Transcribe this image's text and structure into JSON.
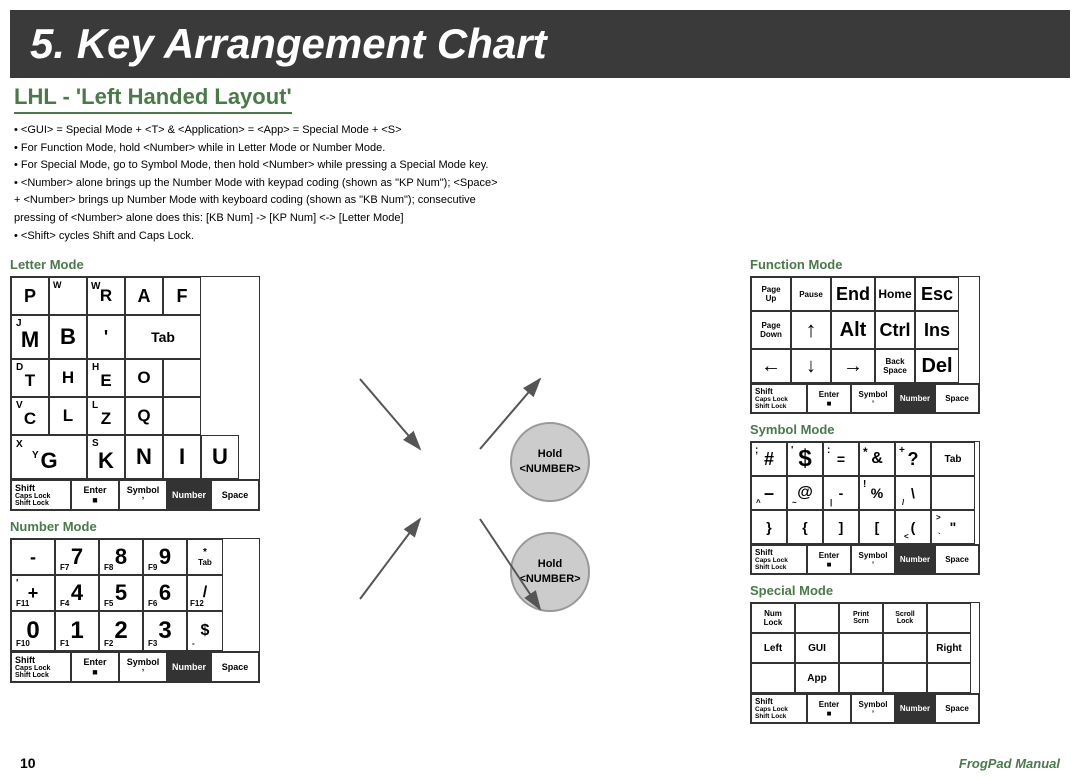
{
  "title": "5. Key Arrangement Chart",
  "subtitle": "LHL - 'Left Handed Layout'",
  "description": [
    "• <GUI> = Special Mode + <T>  &  <Application> = <App> = Special Mode + <S>",
    "• For Function Mode, hold <Number> while in Letter Mode or Number Mode.",
    "• For Special Mode, go to Symbol Mode, then hold <Number> while pressing a Special Mode key.",
    "• <Number> alone brings up the Number Mode with keypad coding (shown as \"KP Num\"); <Space>",
    "+ <Number> brings up Number Mode with keyboard coding (shown as \"KB Num\"); consecutive",
    "pressing of <Number> alone does this: [KB Num]  -> [KP Num] <-> [Letter Mode]",
    "• <Shift> cycles Shift and Caps Lock."
  ],
  "letter_mode": {
    "header": "Letter Mode",
    "rows": [
      [
        "P",
        "W",
        "R",
        "A",
        "F"
      ],
      [
        "J",
        "M B",
        "'",
        "Tab"
      ],
      [
        "D",
        "T",
        "H",
        "E",
        "O"
      ],
      [
        "V",
        "C",
        "L",
        "Z",
        "Q"
      ],
      [
        "",
        "Y G S",
        "N",
        "I",
        "U"
      ],
      [
        "X",
        "",
        "K",
        "",
        ""
      ]
    ]
  },
  "number_mode": {
    "header": "Number Mode"
  },
  "function_mode": {
    "header": "Function Mode"
  },
  "symbol_mode": {
    "header": "Symbol Mode"
  },
  "special_mode": {
    "header": "Special Mode"
  },
  "hold_number": "Hold\n<NUMBER>",
  "page_number": "10",
  "brand": "FrogPad Manual",
  "bottom_row": {
    "shift": "Shift\nCaps Lock\nShift Lock",
    "enter": "Enter",
    "symbol": "Symbol",
    "number": "Number",
    "space": "Space",
    "dot": "■",
    "comma": "ʼ"
  }
}
